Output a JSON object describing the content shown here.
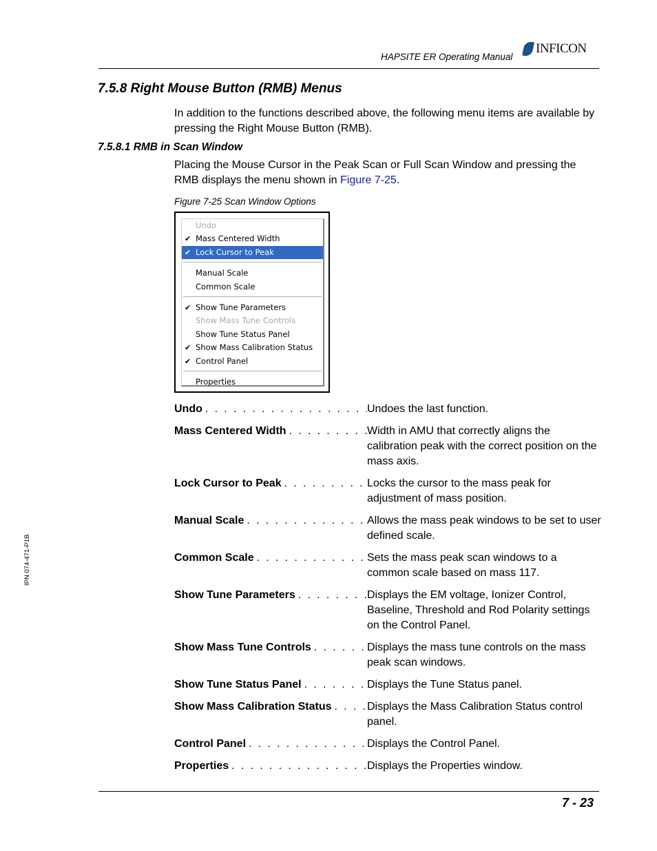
{
  "header": {
    "manual_title": "HAPSITE ER Operating Manual",
    "logo_text": "INFICON",
    "logo_color": "#1f4e8c"
  },
  "section": {
    "heading": "7.5.8  Right Mouse Button (RMB) Menus",
    "intro": "In addition to the functions described above, the following menu items are available by pressing the Right Mouse Button (RMB)."
  },
  "subsection": {
    "heading": "7.5.8.1  RMB in Scan Window",
    "text_before_link": "Placing the Mouse Cursor in the Peak Scan or Full Scan Window and pressing the RMB displays the menu shown in ",
    "link_text": "Figure 7-25",
    "text_after_link": "."
  },
  "figure": {
    "caption": "Figure 7-25  Scan Window Options",
    "menu_groups": [
      [
        {
          "label": "Undo",
          "checked": false,
          "disabled": true,
          "selected": false
        },
        {
          "label": "Mass Centered Width",
          "checked": true,
          "disabled": false,
          "selected": false
        },
        {
          "label": "Lock Cursor to Peak",
          "checked": true,
          "disabled": false,
          "selected": true
        }
      ],
      [
        {
          "label": "Manual Scale",
          "checked": false,
          "disabled": false,
          "selected": false
        },
        {
          "label": "Common Scale",
          "checked": false,
          "disabled": false,
          "selected": false
        }
      ],
      [
        {
          "label": "Show Tune Parameters",
          "checked": true,
          "disabled": false,
          "selected": false
        },
        {
          "label": "Show Mass Tune Controls",
          "checked": false,
          "disabled": true,
          "selected": false
        },
        {
          "label": "Show Tune Status Panel",
          "checked": false,
          "disabled": false,
          "selected": false
        },
        {
          "label": "Show Mass Calibration Status",
          "checked": true,
          "disabled": false,
          "selected": false
        },
        {
          "label": "Control Panel",
          "checked": true,
          "disabled": false,
          "selected": false
        }
      ],
      [
        {
          "label": "Properties",
          "checked": false,
          "disabled": false,
          "selected": false
        }
      ]
    ],
    "check_glyph": "✔",
    "highlight_color": "#316ac5"
  },
  "definitions": [
    {
      "term": "Undo",
      "desc": "Undoes the last function."
    },
    {
      "term": "Mass Centered Width",
      "desc": "Width in AMU that correctly aligns the calibration peak with the correct position on the mass axis."
    },
    {
      "term": "Lock Cursor to Peak",
      "desc": "Locks the cursor to the mass peak for adjustment of mass position."
    },
    {
      "term": "Manual Scale",
      "desc": "Allows the mass peak windows to be set to user defined scale."
    },
    {
      "term": "Common Scale",
      "desc": "Sets the mass peak scan windows to a common scale based on mass 117."
    },
    {
      "term": "Show Tune Parameters",
      "desc": "Displays the EM voltage, Ionizer Control, Baseline, Threshold and Rod Polarity settings on the Control Panel."
    },
    {
      "term": "Show Mass Tune Controls",
      "desc": "Displays the mass tune controls on the mass peak scan windows."
    },
    {
      "term": "Show Tune Status Panel",
      "desc": "Displays the Tune Status panel."
    },
    {
      "term": "Show Mass Calibration Status",
      "desc": "Displays the Mass Calibration Status control panel."
    },
    {
      "term": "Control Panel",
      "desc": "Displays the Control Panel."
    },
    {
      "term": "Properties",
      "desc": "Displays the Properties window."
    }
  ],
  "sidebar": {
    "doc_id": "IPN 074-471-P1B"
  },
  "footer": {
    "page_number": "7 - 23"
  }
}
